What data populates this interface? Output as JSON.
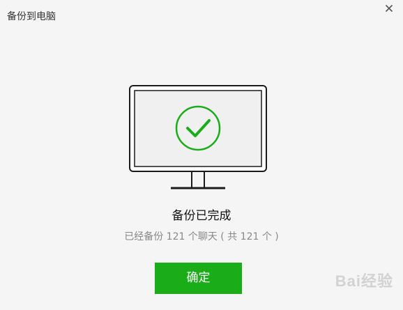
{
  "window": {
    "title": "备份到电脑",
    "close_icon": "close-icon"
  },
  "illustration": {
    "icon": "monitor-check-icon",
    "accent_color": "#1aad19",
    "outline_color": "#1a1a1a"
  },
  "status": {
    "title": "备份已完成",
    "detail": "已经备份 121 个聊天 ( 共 121 个 )"
  },
  "actions": {
    "confirm_label": "确定",
    "confirm_color": "#1aad19"
  },
  "watermark": {
    "text": "Bai经验"
  }
}
